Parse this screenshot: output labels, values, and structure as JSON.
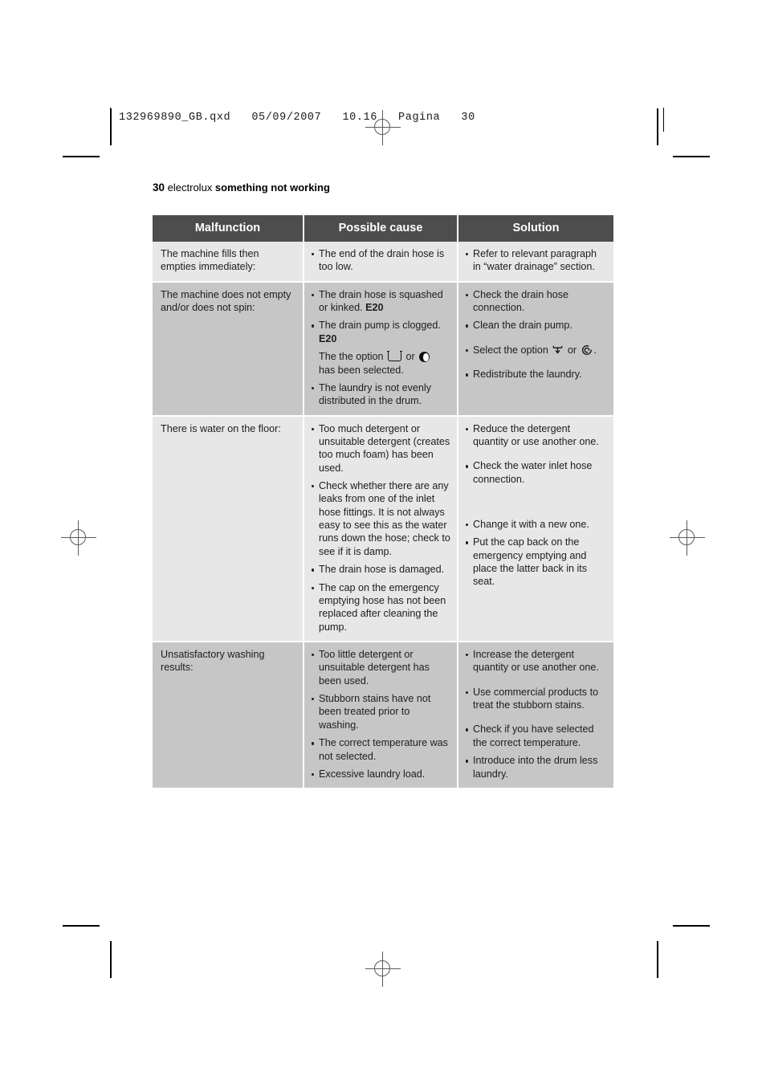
{
  "slug": {
    "text": "132969890_GB.qxd   05/09/2007   10.16   Pagina   30"
  },
  "page_header": {
    "page_number": "30",
    "brand": "electrolux",
    "section": "something not working"
  },
  "table": {
    "columns": [
      "Malfunction",
      "Possible cause",
      "Solution"
    ],
    "rows": [
      {
        "malfunction": "The machine fills then empties immediately:",
        "causes": [
          {
            "text": "The end of the drain hose is too low."
          }
        ],
        "solutions": [
          {
            "text": "Refer to relevant paragraph in “water drainage” section."
          }
        ]
      },
      {
        "malfunction": "The machine does not empty and/or does not spin:",
        "causes": [
          {
            "text": "The drain hose is squashed or kinked. ",
            "bold_suffix": "E20"
          },
          {
            "text": "The drain pump is clogged. ",
            "bold_suffix": "E20"
          },
          {
            "text": "The the option ",
            "icon1": "rinse-hold-icon",
            "mid": " or ",
            "icon2": "night-cycle-icon",
            "tail": " has been selected.",
            "no_bullet": true
          },
          {
            "text": "The laundry is not evenly distributed in the drum."
          }
        ],
        "solutions": [
          {
            "text": "Check the drain hose connection."
          },
          {
            "text": "Clean the drain pump."
          },
          {
            "text": "Select the option ",
            "icon1": "drain-icon",
            "mid": " or ",
            "icon2": "spin-icon",
            "tail": "."
          },
          {
            "text": "Redistribute the laundry."
          }
        ]
      },
      {
        "malfunction": "There is water on the floor:",
        "causes": [
          {
            "text": "Too much detergent or unsuitable detergent (creates too much foam) has been used."
          },
          {
            "text": "Check whether there are any leaks from one of the inlet hose fittings. It is not always easy to see this as the water runs down the hose; check to see if it is damp."
          },
          {
            "text": "The drain hose is damaged."
          },
          {
            "text": "The cap on the emergency emptying hose has not been replaced after cleaning the pump."
          }
        ],
        "solutions": [
          {
            "text": "Reduce the detergent quantity or use another one."
          },
          {
            "text": "Check the water inlet hose connection."
          },
          {
            "text": "Change it with a new one."
          },
          {
            "text": "Put the cap back on the emergency emptying and place the latter back in its seat."
          }
        ]
      },
      {
        "malfunction": "Unsatisfactory washing results:",
        "causes": [
          {
            "text": "Too little detergent or unsuitable detergent has been used."
          },
          {
            "text": "Stubborn stains have not been treated prior to washing."
          },
          {
            "text": "The correct temperature was not selected."
          },
          {
            "text": "Excessive laundry load."
          }
        ],
        "solutions": [
          {
            "text": "Increase the detergent quantity or use another one."
          },
          {
            "text": "Use commercial products to treat the stubborn stains."
          },
          {
            "text": "Check if you have selected the correct temperature."
          },
          {
            "text": "Introduce into the drum less laundry."
          }
        ]
      }
    ]
  },
  "colors": {
    "header_bg": "#4d4d4d",
    "header_text": "#ffffff",
    "row_light": "#e7e7e7",
    "row_dark": "#c6c6c6"
  }
}
